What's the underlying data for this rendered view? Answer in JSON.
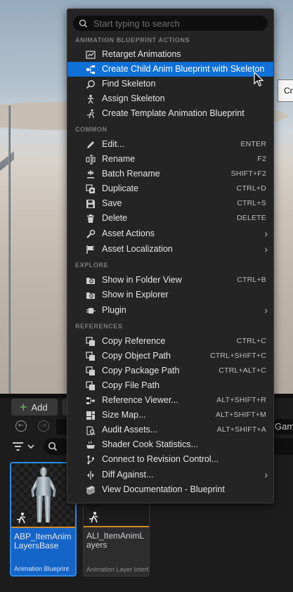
{
  "viewport": {
    "tooltip_text": "Cr"
  },
  "content_browser": {
    "add_label": "Add",
    "path_end": "Gam",
    "assets": [
      {
        "name": "ABP_ItemAnimLayersBase",
        "type": "Animation Blueprint",
        "selected": true
      },
      {
        "name": "ALI_ItemAnimLayers",
        "type": "Animation Layer Interface",
        "selected": false
      }
    ]
  },
  "menu": {
    "search_placeholder": "Start typing to search",
    "sections": {
      "anim": "ANIMATION BLUEPRINT ACTIONS",
      "common": "COMMON",
      "explore": "EXPLORE",
      "references": "REFERENCES"
    },
    "items": {
      "retarget": {
        "label": "Retarget Animations",
        "icon": "retarget-icon"
      },
      "create_child": {
        "label": "Create Child Anim Blueprint with Skeleton",
        "icon": "hierarchy-icon"
      },
      "find_skeleton": {
        "label": "Find Skeleton",
        "icon": "magnifier-icon"
      },
      "assign_skeleton": {
        "label": "Assign Skeleton",
        "icon": "skeleton-icon"
      },
      "create_template": {
        "label": "Create Template Animation Blueprint",
        "icon": "running-figure-icon"
      },
      "edit": {
        "label": "Edit...",
        "shortcut": "ENTER",
        "icon": "pencil-icon"
      },
      "rename": {
        "label": "Rename",
        "shortcut": "F2",
        "icon": "text-cursor-icon"
      },
      "batch_rename": {
        "label": "Batch Rename",
        "shortcut": "SHIFT+F2",
        "icon": "asterisk-icon"
      },
      "duplicate": {
        "label": "Duplicate",
        "shortcut": "CTRL+D",
        "icon": "duplicate-icon"
      },
      "save": {
        "label": "Save",
        "shortcut": "CTRL+S",
        "icon": "floppy-icon"
      },
      "delete": {
        "label": "Delete",
        "shortcut": "DELETE",
        "icon": "trash-icon"
      },
      "asset_actions": {
        "label": "Asset Actions",
        "icon": "wrench-icon"
      },
      "asset_localization": {
        "label": "Asset Localization",
        "icon": "flag-icon"
      },
      "show_folder": {
        "label": "Show in Folder View",
        "shortcut": "CTRL+B",
        "icon": "folder-search-icon"
      },
      "show_explorer": {
        "label": "Show in Explorer",
        "icon": "folder-icon"
      },
      "plugin": {
        "label": "Plugin",
        "icon": "plugin-icon"
      },
      "copy_reference": {
        "label": "Copy Reference",
        "shortcut": "CTRL+C",
        "icon": "copy-icon"
      },
      "copy_object_path": {
        "label": "Copy Object Path",
        "shortcut": "CTRL+SHIFT+C",
        "icon": "copy-icon"
      },
      "copy_package_path": {
        "label": "Copy Package Path",
        "shortcut": "CTRL+ALT+C",
        "icon": "copy-icon"
      },
      "copy_file_path": {
        "label": "Copy File Path",
        "icon": "copy-icon"
      },
      "reference_viewer": {
        "label": "Reference Viewer...",
        "shortcut": "ALT+SHIFT+R",
        "icon": "graph-icon"
      },
      "size_map": {
        "label": "Size Map...",
        "shortcut": "ALT+SHIFT+M",
        "icon": "size-map-icon"
      },
      "audit_assets": {
        "label": "Audit Assets...",
        "shortcut": "ALT+SHIFT+A",
        "icon": "audit-icon"
      },
      "shader_cook": {
        "label": "Shader Cook Statistics...",
        "icon": "cooking-pot-icon"
      },
      "revision_control": {
        "label": "Connect to Revision Control...",
        "icon": "branch-icon"
      },
      "diff_against": {
        "label": "Diff Against...",
        "icon": "diff-icon"
      },
      "view_docs": {
        "label": "View Documentation - Blueprint",
        "icon": "book-icon"
      }
    }
  },
  "colors": {
    "highlight": "#0f70d7",
    "selected_tile": "#1565c8",
    "type_stripe": "#d08a2a",
    "add_plus": "#5fc35f"
  }
}
